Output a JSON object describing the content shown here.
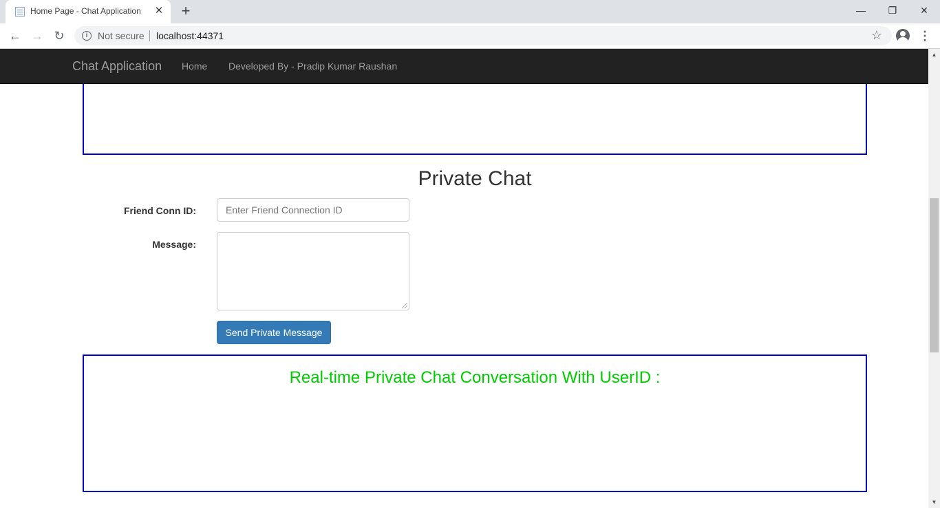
{
  "browser": {
    "tab_title": "Home Page - Chat Application",
    "tab_close": "✕",
    "new_tab": "+",
    "minimize": "—",
    "restore": "❐",
    "close": "✕",
    "security_label": "Not secure",
    "url": "localhost:44371"
  },
  "navbar": {
    "brand": "Chat Application",
    "links": [
      "Home",
      "Developed By - Pradip Kumar Raushan"
    ]
  },
  "private_chat": {
    "title": "Private Chat",
    "friend_label": "Friend Conn ID:",
    "friend_placeholder": "Enter Friend Connection ID",
    "message_label": "Message:",
    "send_button": "Send Private Message"
  },
  "conversation": {
    "title": "Real-time Private Chat Conversation With UserID :"
  },
  "colors": {
    "box_border": "#0000cd",
    "conversation_title": "#00cc00",
    "navbar_bg": "#222222",
    "button_bg": "#337ab7"
  }
}
